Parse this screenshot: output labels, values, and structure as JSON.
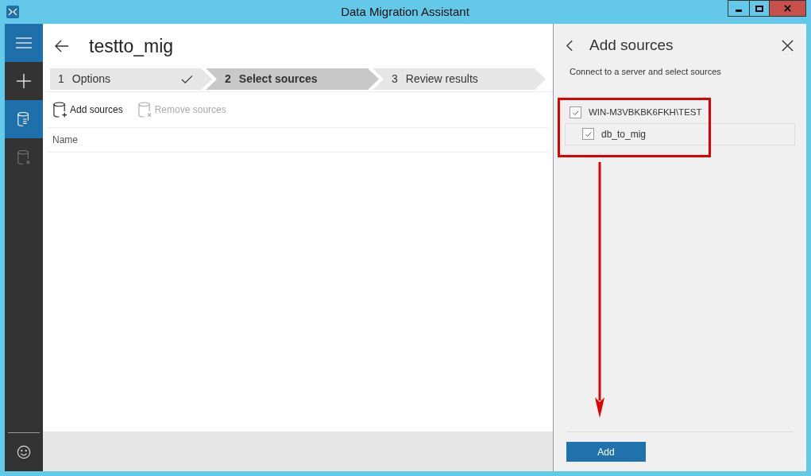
{
  "window": {
    "title": "Data Migration Assistant"
  },
  "sidebar": {
    "items": [
      {
        "kind": "new",
        "selected": false,
        "disabled": false
      },
      {
        "kind": "assessment",
        "selected": true,
        "disabled": false
      },
      {
        "kind": "migration",
        "selected": false,
        "disabled": true
      }
    ]
  },
  "project": {
    "title": "testto_mig"
  },
  "steps": [
    {
      "number": "1",
      "label": "Options",
      "selected": false,
      "completed": true
    },
    {
      "number": "2",
      "label": "Select sources",
      "selected": true,
      "completed": false
    },
    {
      "number": "3",
      "label": "Review results",
      "selected": false,
      "completed": false
    }
  ],
  "toolbar": [
    {
      "kind": "add",
      "label": "Add sources",
      "disabled": false
    },
    {
      "kind": "remove",
      "label": "Remove sources",
      "disabled": true
    }
  ],
  "table": {
    "columns": [
      "Name"
    ]
  },
  "panel": {
    "title": "Add sources",
    "subtitle": "Connect to a server and select sources",
    "tree": [
      {
        "label": "WIN-M3VBKBK6FKH\\TEST",
        "checked": true,
        "children": [
          {
            "label": "db_to_mig",
            "checked": true
          }
        ]
      }
    ],
    "button": "Add"
  }
}
